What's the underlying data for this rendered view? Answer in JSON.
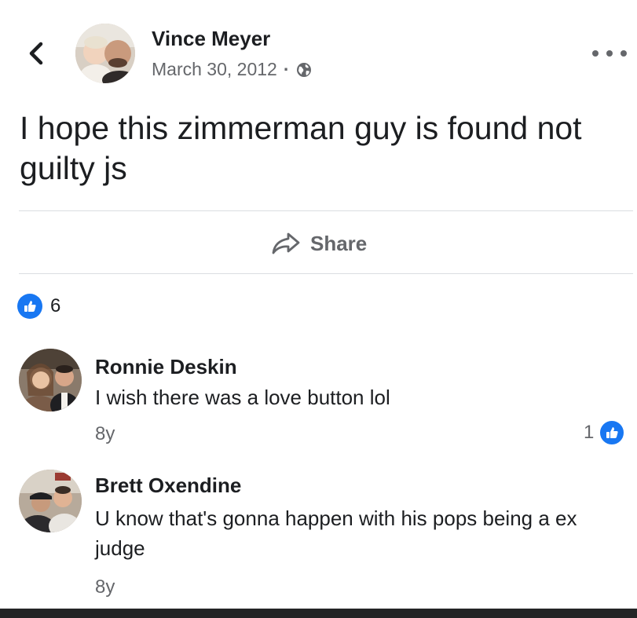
{
  "post": {
    "author_name": "Vince Meyer",
    "date": "March 30, 2012",
    "separator": "·",
    "audience_icon": "globe-icon",
    "text": "I hope this zimmerman guy is found not guilty js",
    "share_label": "Share",
    "like_count": "6"
  },
  "header": {
    "back_icon": "chevron-left-icon",
    "more_icon": "more-horizontal-icon"
  },
  "comments": [
    {
      "name": "Ronnie Deskin",
      "text": "I wish there was a love button lol",
      "time": "8y",
      "like_count": "1"
    },
    {
      "name": "Brett Oxendine",
      "text": "U know that's gonna happen with his pops being a ex judge",
      "time": "8y"
    }
  ],
  "colors": {
    "like_blue": "#1877f2",
    "secondary_text": "#65676b",
    "divider": "#dadde1"
  }
}
